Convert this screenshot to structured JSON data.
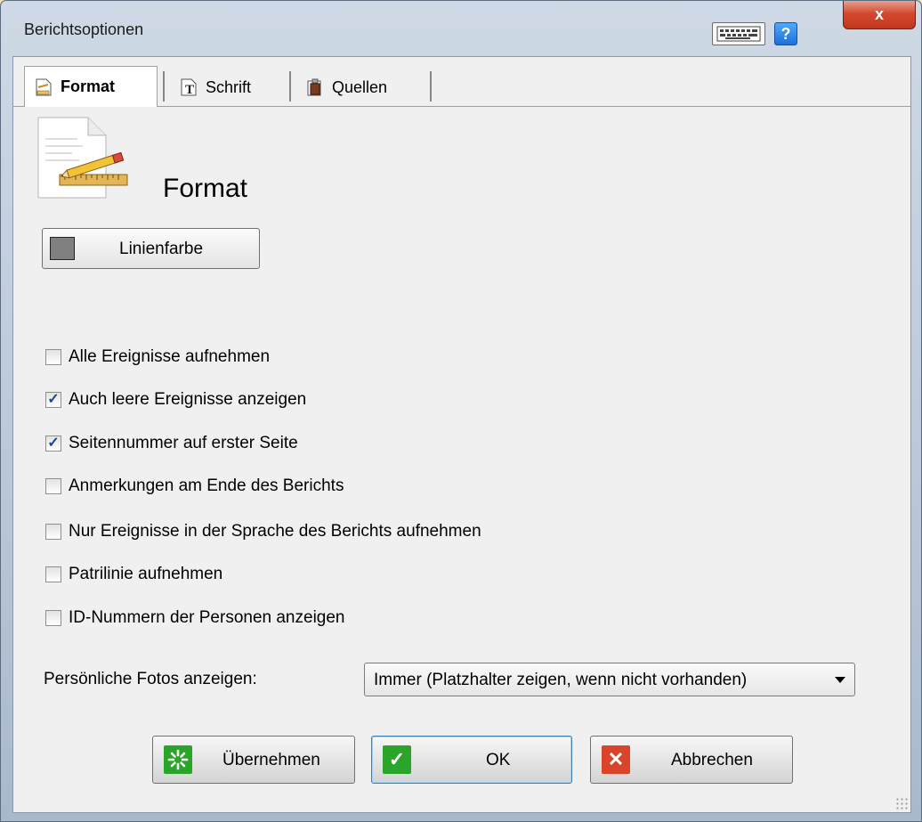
{
  "window": {
    "title": "Berichtsoptionen",
    "help_label": "?",
    "close_label": "x"
  },
  "tabs": [
    {
      "label": "Format",
      "icon": "format-page-icon",
      "active": true
    },
    {
      "label": "Schrift",
      "icon": "font-icon",
      "active": false
    },
    {
      "label": "Quellen",
      "icon": "sources-icon",
      "active": false
    }
  ],
  "page": {
    "title": "Format",
    "line_color_button": "Linienfarbe",
    "line_color": "#808080",
    "options": [
      {
        "label": "Alle Ereignisse aufnehmen",
        "checked": false
      },
      {
        "label": "Auch leere Ereignisse anzeigen",
        "checked": true
      },
      {
        "label": "Seitennummer auf erster Seite",
        "checked": true
      },
      {
        "label": "Anmerkungen am Ende des Berichts",
        "checked": false
      },
      {
        "label": "Nur Ereignisse in der Sprache des Berichts aufnehmen",
        "checked": false
      },
      {
        "label": "Patrilinie aufnehmen",
        "checked": false
      },
      {
        "label": "ID-Nummern der Personen anzeigen",
        "checked": false
      }
    ],
    "photo_label": "Persönliche Fotos anzeigen:",
    "photo_value": "Immer (Platzhalter zeigen, wenn nicht vorhanden)"
  },
  "buttons": {
    "apply": "Übernehmen",
    "ok": "OK",
    "cancel": "Abbrechen"
  },
  "colors": {
    "apply_icon": "#2aa52a",
    "ok_icon": "#2aa52a",
    "cancel_icon": "#d9442b",
    "check_mark": "#21468e"
  }
}
